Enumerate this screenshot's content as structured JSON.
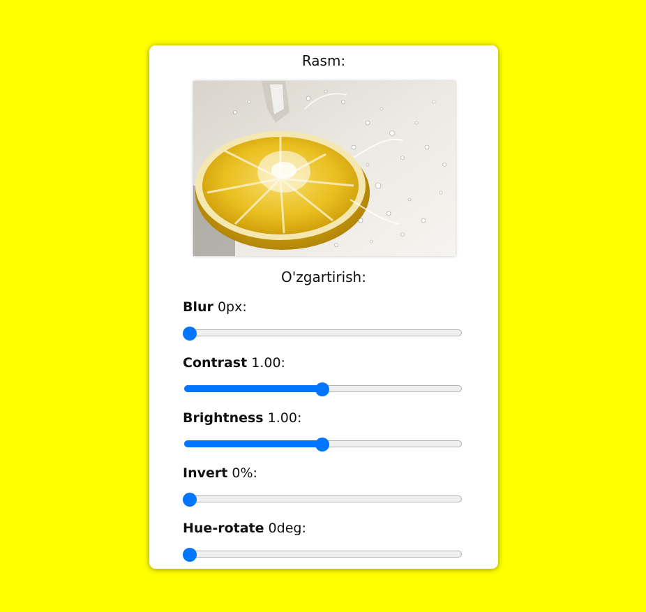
{
  "card": {
    "image_heading": "Rasm:",
    "controls_heading": "O'zgartirish:"
  },
  "image": {
    "subject": "lemon-splash-photo"
  },
  "controls": [
    {
      "name": "Blur",
      "value_text": "0px:",
      "value": 0,
      "min": 0,
      "max": 10
    },
    {
      "name": "Contrast",
      "value_text": "1.00:",
      "value": 1.0,
      "min": 0,
      "max": 2
    },
    {
      "name": "Brightness",
      "value_text": "1.00:",
      "value": 1.0,
      "min": 0,
      "max": 2
    },
    {
      "name": "Invert",
      "value_text": "0%:",
      "value": 0,
      "min": 0,
      "max": 100
    },
    {
      "name": "Hue-rotate",
      "value_text": "0deg:",
      "value": 0,
      "min": 0,
      "max": 360
    }
  ],
  "colors": {
    "page_background": "#ffff00",
    "accent": "#0075ff",
    "track": "#efefef"
  }
}
